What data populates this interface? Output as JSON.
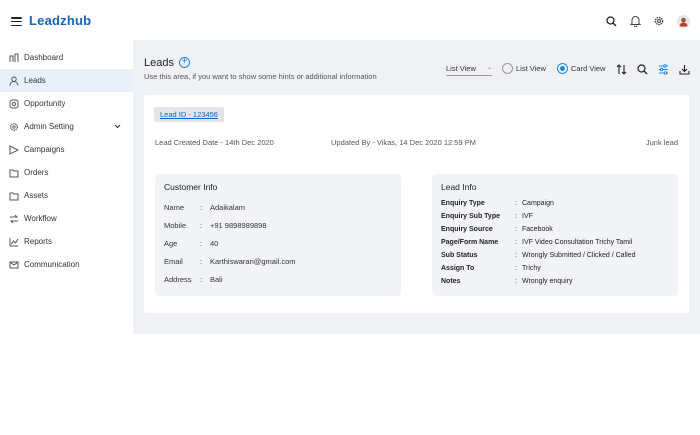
{
  "app": {
    "brand": "Leadzhub"
  },
  "header_icons": [
    "search-icon",
    "bell-icon",
    "gear-icon",
    "avatar"
  ],
  "sidebar": {
    "items": [
      {
        "label": "Dashboard",
        "icon": "dashboard-icon"
      },
      {
        "label": "Leads",
        "icon": "user-icon",
        "active": true
      },
      {
        "label": "Opportunity",
        "icon": "target-icon"
      },
      {
        "label": "Admin Setting",
        "icon": "gear-icon",
        "has_children": true
      },
      {
        "label": "Campaigns",
        "icon": "send-icon"
      },
      {
        "label": "Orders",
        "icon": "folder-icon"
      },
      {
        "label": "Assets",
        "icon": "folder-icon"
      },
      {
        "label": "Workflow",
        "icon": "workflow-icon"
      },
      {
        "label": "Reports",
        "icon": "chart-icon"
      },
      {
        "label": "Communication",
        "icon": "mail-icon"
      }
    ]
  },
  "page": {
    "title": "Leads",
    "hint": "Use this area, if you want to show some hints or additional information",
    "view_select": "List View",
    "radio_list": "List View",
    "radio_card": "Card View",
    "selected_view": "Card View"
  },
  "lead": {
    "id_label": "Lead ID - 123456",
    "created": "Lead Created Date - 14th Dec 2020",
    "updated": "Updated By - Vikas, 14 Dec 2020 12:59 PM",
    "status": "Junk lead",
    "customer_info": {
      "title": "Customer Info",
      "rows": [
        {
          "label": "Name",
          "value": "Adaikalam"
        },
        {
          "label": "Mobile",
          "value": "+91 9898989898"
        },
        {
          "label": "Age",
          "value": "40"
        },
        {
          "label": "Email",
          "value": "Karthiswaran@gmail.com"
        },
        {
          "label": "Address",
          "value": "Bali"
        }
      ]
    },
    "lead_info": {
      "title": "Lead Info",
      "rows": [
        {
          "label": "Enquiry Type",
          "value": "Campaign"
        },
        {
          "label": "Enquiry Sub Type",
          "value": "IVF"
        },
        {
          "label": "Enquiry Source",
          "value": "Facebook"
        },
        {
          "label": "Page/Form Name",
          "value": "IVF Video Consultation Trichy Tamil"
        },
        {
          "label": "Sub Status",
          "value": "Wrongly Submitted / Clicked / Called"
        },
        {
          "label": "Assign To",
          "value": "Trichy"
        },
        {
          "label": "Notes",
          "value": "Wrongly enquiry"
        }
      ]
    }
  },
  "colors": {
    "accent": "#1e88e5",
    "brand": "#1565c0",
    "bg": "#f0f1f5",
    "active_bg": "#e8f0fa"
  }
}
